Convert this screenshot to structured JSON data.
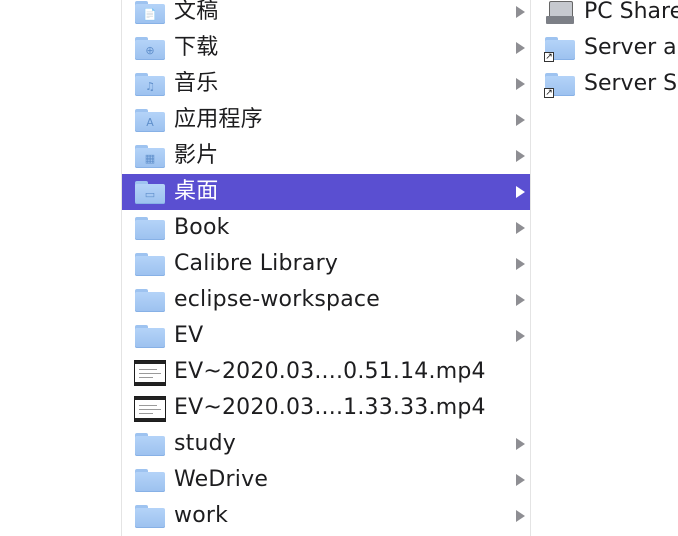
{
  "browser_column": {
    "items": [
      {
        "label": "文稿",
        "kind": "folder",
        "glyph": "📄",
        "icon_name": "documents-folder-icon",
        "has_children": true,
        "selected": false
      },
      {
        "label": "下载",
        "kind": "folder",
        "glyph": "⊕",
        "icon_name": "downloads-folder-icon",
        "has_children": true,
        "selected": false
      },
      {
        "label": "音乐",
        "kind": "folder",
        "glyph": "♫",
        "icon_name": "music-folder-icon",
        "has_children": true,
        "selected": false
      },
      {
        "label": "应用程序",
        "kind": "folder",
        "glyph": "A",
        "icon_name": "applications-folder-icon",
        "has_children": true,
        "selected": false
      },
      {
        "label": "影片",
        "kind": "folder",
        "glyph": "▦",
        "icon_name": "movies-folder-icon",
        "has_children": true,
        "selected": false
      },
      {
        "label": "桌面",
        "kind": "folder",
        "glyph": "▭",
        "icon_name": "desktop-folder-icon",
        "has_children": true,
        "selected": true
      },
      {
        "label": "Book",
        "kind": "folder",
        "glyph": "",
        "icon_name": "folder-icon",
        "has_children": true,
        "selected": false
      },
      {
        "label": "Calibre Library",
        "kind": "folder",
        "glyph": "",
        "icon_name": "folder-icon",
        "has_children": true,
        "selected": false
      },
      {
        "label": "eclipse-workspace",
        "kind": "folder",
        "glyph": "",
        "icon_name": "folder-icon",
        "has_children": true,
        "selected": false
      },
      {
        "label": "EV",
        "kind": "folder",
        "glyph": "",
        "icon_name": "folder-icon",
        "has_children": true,
        "selected": false
      },
      {
        "label": "EV~2020.03....0.51.14.mp4",
        "kind": "video",
        "glyph": "",
        "icon_name": "video-thumbnail-icon",
        "has_children": false,
        "selected": false
      },
      {
        "label": "EV~2020.03....1.33.33.mp4",
        "kind": "video",
        "glyph": "",
        "icon_name": "video-thumbnail-icon",
        "has_children": false,
        "selected": false
      },
      {
        "label": "study",
        "kind": "folder",
        "glyph": "",
        "icon_name": "folder-icon",
        "has_children": true,
        "selected": false
      },
      {
        "label": "WeDrive",
        "kind": "folder",
        "glyph": "",
        "icon_name": "folder-icon",
        "has_children": true,
        "selected": false
      },
      {
        "label": "work",
        "kind": "folder",
        "glyph": "",
        "icon_name": "folder-icon",
        "has_children": true,
        "selected": false
      }
    ]
  },
  "right_column": {
    "items": [
      {
        "label": "PC Shared",
        "kind": "server",
        "icon_name": "shared-server-icon"
      },
      {
        "label": "Server a",
        "kind": "alias-folder",
        "icon_name": "alias-folder-icon"
      },
      {
        "label": "Server S",
        "kind": "alias-folder",
        "icon_name": "alias-folder-icon"
      }
    ]
  },
  "colors": {
    "selection": "#5a4fd1",
    "folder": "#a9cbf6",
    "chevron": "#8e8e93"
  }
}
